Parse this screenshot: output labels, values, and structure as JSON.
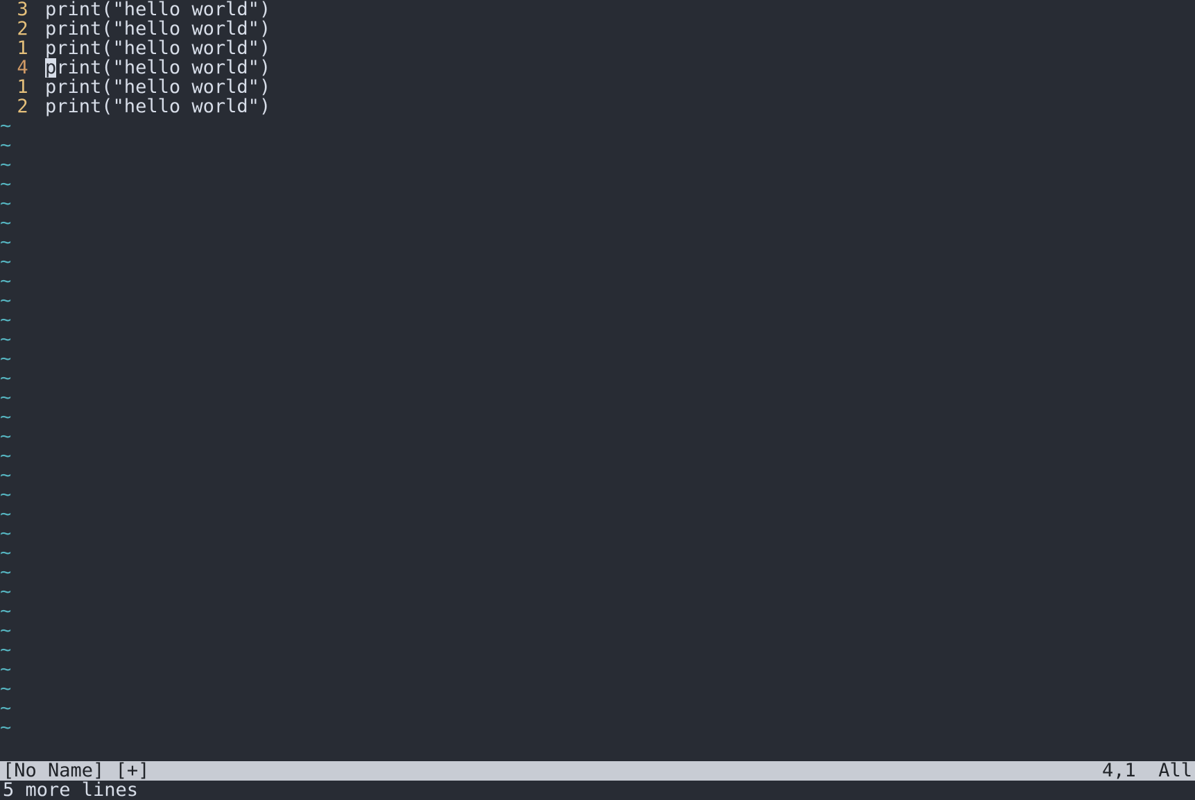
{
  "lines": [
    {
      "num": "3",
      "current": false,
      "text": "print(\"hello world\")",
      "cursor_col": -1
    },
    {
      "num": "2",
      "current": false,
      "text": "print(\"hello world\")",
      "cursor_col": -1
    },
    {
      "num": "1",
      "current": false,
      "text": "print(\"hello world\")",
      "cursor_col": -1
    },
    {
      "num": "4",
      "current": true,
      "text": "print(\"hello world\")",
      "cursor_col": 0
    },
    {
      "num": "1",
      "current": false,
      "text": "print(\"hello world\")",
      "cursor_col": -1
    },
    {
      "num": "2",
      "current": false,
      "text": "print(\"hello world\")",
      "cursor_col": -1
    }
  ],
  "empty_line_marker": "~",
  "empty_rows": 32,
  "status": {
    "filename": "[No Name]",
    "modified": "[+]",
    "position": "4,1",
    "percent": "All"
  },
  "cmdline": "5 more lines"
}
